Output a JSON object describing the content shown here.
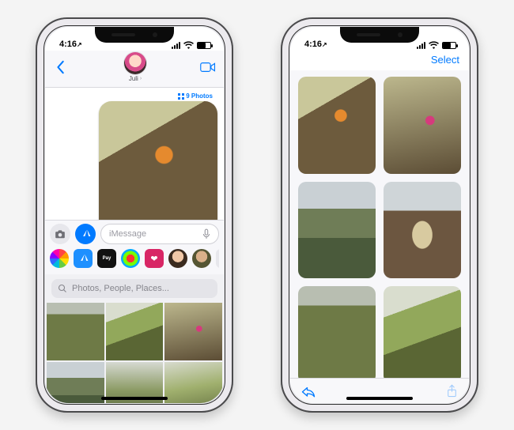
{
  "status": {
    "time": "4:16",
    "arrow": "↗"
  },
  "left": {
    "contact_name": "Juli",
    "photos_count_label": "9 Photos",
    "input_placeholder": "iMessage",
    "search_placeholder": "Photos, People, Places...",
    "apps": {
      "photos": "Photos",
      "store": "App Store",
      "pay": "Pay",
      "activity": "Activity",
      "heart": "Digital Touch",
      "memoji1": "Memoji",
      "memoji2": "Memoji",
      "more": "More"
    }
  },
  "right": {
    "select_label": "Select"
  },
  "colors": {
    "tint": "#007aff"
  }
}
